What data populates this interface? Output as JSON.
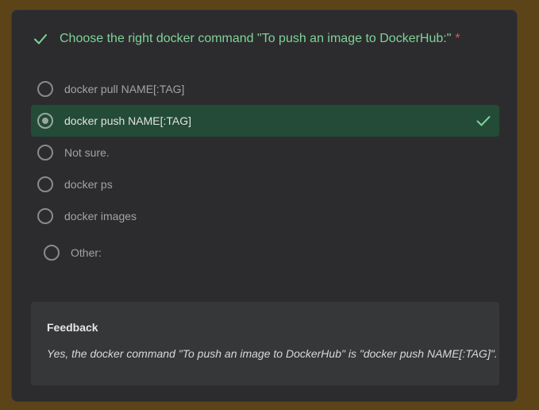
{
  "question": {
    "title": "Choose the right docker command \"To push an image to DockerHub:\"",
    "required_marker": "*",
    "status_icon": "check-icon"
  },
  "options": [
    {
      "label": "docker pull NAME[:TAG]",
      "selected": false
    },
    {
      "label": "docker push NAME[:TAG]",
      "selected": true,
      "correct": true
    },
    {
      "label": "Not sure.",
      "selected": false
    },
    {
      "label": "docker ps",
      "selected": false
    },
    {
      "label": "docker images",
      "selected": false
    }
  ],
  "other": {
    "label": "Other:"
  },
  "feedback": {
    "heading": "Feedback",
    "text": "Yes, the docker command \"To push an image to DockerHub\" is \"docker push NAME[:TAG]\"."
  },
  "colors": {
    "page_background": "#5d4418",
    "card_background": "#2c2c2e",
    "accent_green": "#7fd39a",
    "selected_background": "#234b37",
    "required_red": "#e2574c",
    "feedback_background": "#363739"
  }
}
